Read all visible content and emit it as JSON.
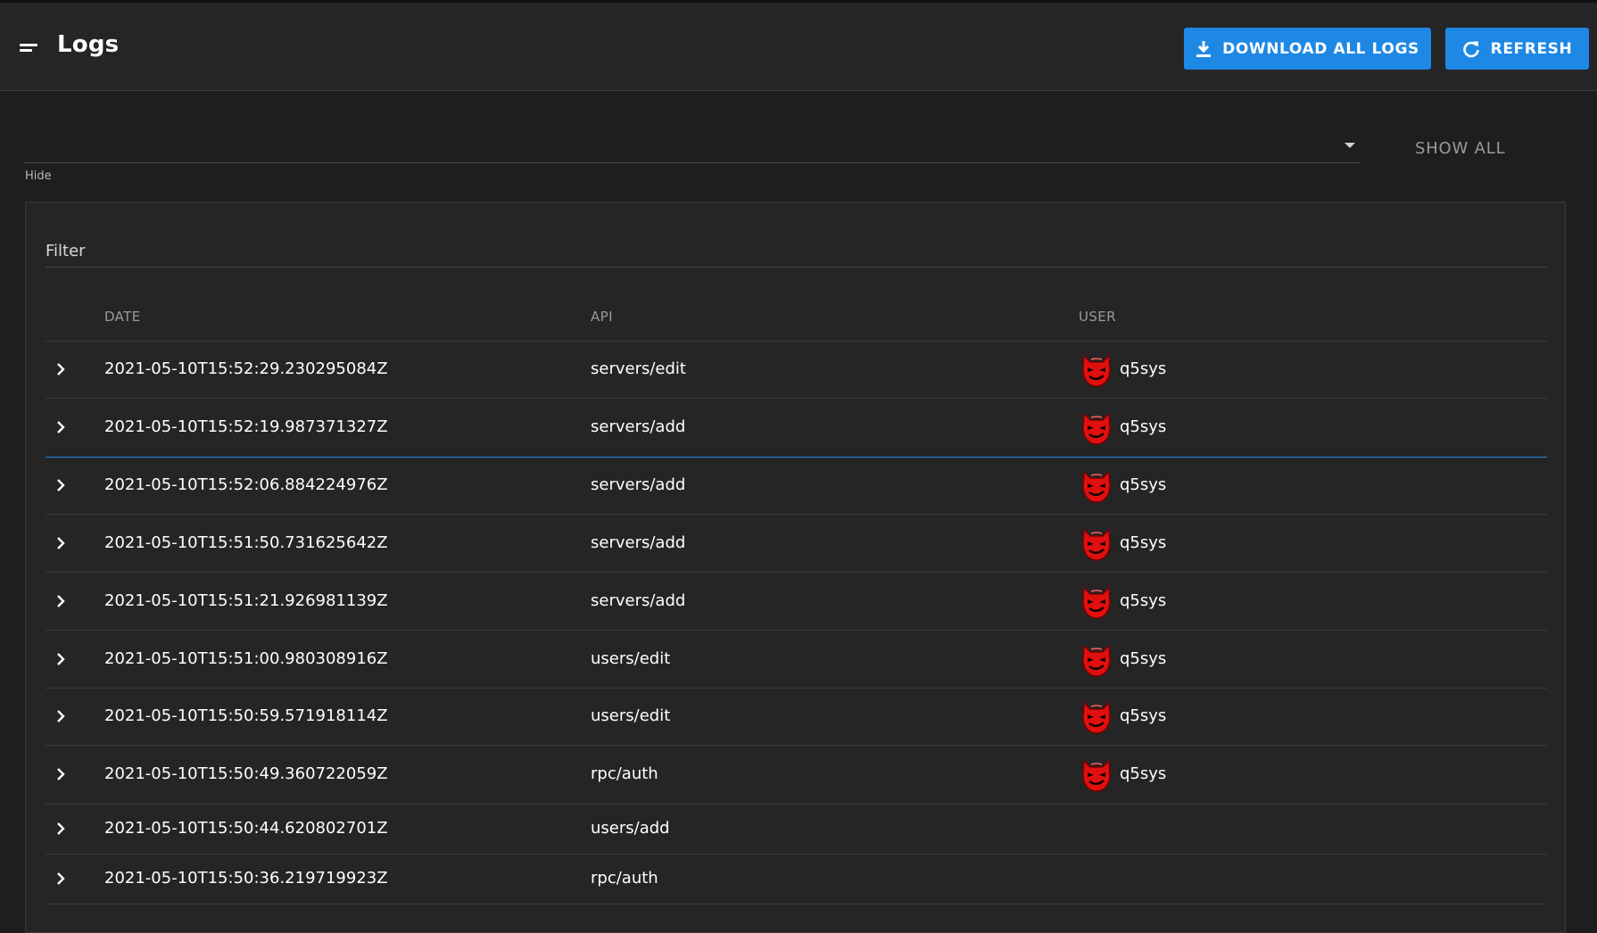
{
  "header": {
    "title": "Logs",
    "download_label": "DOWNLOAD ALL LOGS",
    "refresh_label": "REFRESH"
  },
  "controls": {
    "select_value": "",
    "hint": "Hide",
    "show_all_label": "SHOW ALL"
  },
  "filter": {
    "label": "Filter"
  },
  "table": {
    "columns": {
      "date": "DATE",
      "api": "API",
      "user": "USER"
    },
    "rows": [
      {
        "date": "2021-05-10T15:52:29.230295084Z",
        "api": "servers/edit",
        "user": "q5sys"
      },
      {
        "date": "2021-05-10T15:52:19.987371327Z",
        "api": "servers/add",
        "user": "q5sys"
      },
      {
        "date": "2021-05-10T15:52:06.884224976Z",
        "api": "servers/add",
        "user": "q5sys"
      },
      {
        "date": "2021-05-10T15:51:50.731625642Z",
        "api": "servers/add",
        "user": "q5sys"
      },
      {
        "date": "2021-05-10T15:51:21.926981139Z",
        "api": "servers/add",
        "user": "q5sys"
      },
      {
        "date": "2021-05-10T15:51:00.980308916Z",
        "api": "users/edit",
        "user": "q5sys"
      },
      {
        "date": "2021-05-10T15:50:59.571918114Z",
        "api": "users/edit",
        "user": "q5sys"
      },
      {
        "date": "2021-05-10T15:50:49.360722059Z",
        "api": "rpc/auth",
        "user": "q5sys"
      },
      {
        "date": "2021-05-10T15:50:44.620802701Z",
        "api": "users/add",
        "user": ""
      },
      {
        "date": "2021-05-10T15:50:36.219719923Z",
        "api": "rpc/auth",
        "user": ""
      }
    ]
  },
  "icons": {
    "menu": "menu-icon",
    "download": "download-icon",
    "refresh": "refresh-icon",
    "expand": "chevron-right-icon",
    "avatar": "devil-avatar-icon"
  },
  "colors": {
    "accent": "#1e88e5",
    "background": "#1e1e1e",
    "surface": "#252525",
    "avatar": "#e01010"
  }
}
